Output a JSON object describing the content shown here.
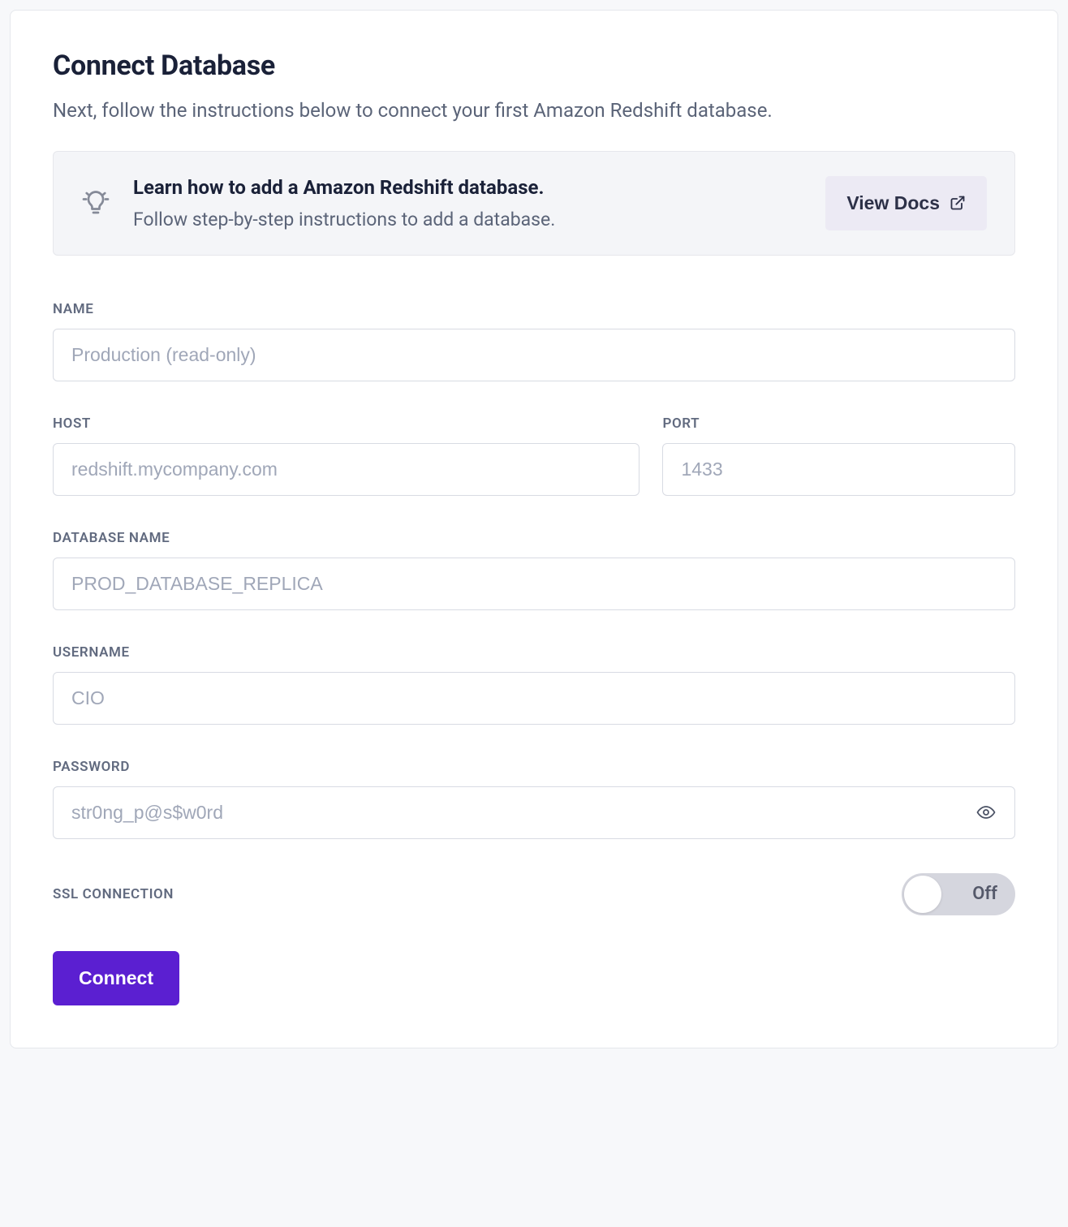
{
  "header": {
    "title": "Connect Database",
    "subtitle": "Next, follow the instructions below to connect your first Amazon Redshift database."
  },
  "callout": {
    "title": "Learn how to add a Amazon Redshift database.",
    "description": "Follow step-by-step instructions to add a database.",
    "docs_label": "View Docs"
  },
  "fields": {
    "name": {
      "label": "NAME",
      "placeholder": "Production (read-only)",
      "value": ""
    },
    "host": {
      "label": "HOST",
      "placeholder": "redshift.mycompany.com",
      "value": ""
    },
    "port": {
      "label": "PORT",
      "placeholder": "1433",
      "value": ""
    },
    "database_name": {
      "label": "DATABASE NAME",
      "placeholder": "PROD_DATABASE_REPLICA",
      "value": ""
    },
    "username": {
      "label": "USERNAME",
      "placeholder": "CIO",
      "value": ""
    },
    "password": {
      "label": "PASSWORD",
      "placeholder": "str0ng_p@s$w0rd",
      "value": ""
    },
    "ssl": {
      "label": "SSL CONNECTION",
      "state_label": "Off",
      "enabled": false
    }
  },
  "actions": {
    "connect_label": "Connect"
  }
}
